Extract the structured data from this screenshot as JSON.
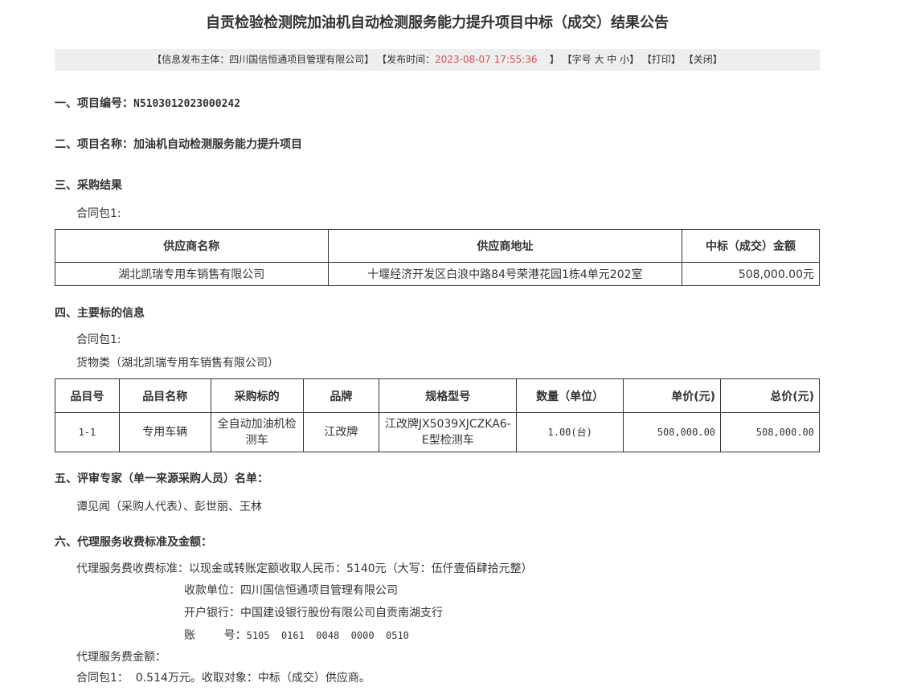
{
  "title": "自贡检验检测院加油机自动检测服务能力提升项目中标（成交）结果公告",
  "meta": {
    "publisher": "【信息发布主体：四川国信恒通项目管理有限公司】",
    "time_label": "【发布时间：",
    "time_value": "2023-08-07 17:55:36",
    "time_close": "】",
    "font_size": "【字号 大 中 小】",
    "print": "【打印】",
    "close": "【关闭】"
  },
  "sec1": {
    "label": "一、项目编号：",
    "value": "N5103012023000242"
  },
  "sec2": {
    "label": "二、项目名称：",
    "value": "加油机自动检测服务能力提升项目"
  },
  "sec3": {
    "heading": "三、采购结果",
    "package": "合同包1:",
    "headers": [
      "供应商名称",
      "供应商地址",
      "中标（成交）金额"
    ],
    "row": [
      "湖北凯瑞专用车销售有限公司",
      "十堰经济开发区白浪中路84号荣港花园1栋4单元202室",
      "508,000.00元"
    ]
  },
  "sec4": {
    "heading": "四、主要标的信息",
    "package": "合同包1:",
    "category": "货物类（湖北凯瑞专用车销售有限公司）",
    "headers": [
      "品目号",
      "品目名称",
      "采购标的",
      "品牌",
      "规格型号",
      "数量（单位）",
      "单价(元)",
      "总价(元)"
    ],
    "row": [
      "1-1",
      "专用车辆",
      "全自动加油机检测车",
      "江改牌",
      "江改牌JX5039XJCZKA6-E型检测车",
      "1.00(台)",
      "508,000.00",
      "508,000.00"
    ]
  },
  "sec5": {
    "heading": "五、评审专家（单一来源采购人员）名单：",
    "names": "谭见闻（采购人代表）、彭世丽、王林"
  },
  "sec6": {
    "heading": "六、代理服务收费标准及金额：",
    "standard": "代理服务费收费标准：以现金或转账定额收取人民币：5140元（大写：伍仟壹佰肆拾元整）",
    "payee": "收款单位：四川国信恒通项目管理有限公司",
    "bank": "开户银行：中国建设银行股份有限公司自贡南湖支行",
    "account_label": "账        号：",
    "account_value": "5105  0161  0048  0000  0510",
    "fee_label": "代理服务费金额：",
    "fee_detail": "合同包1：  0.514万元。收取对象：中标（成交）供应商。"
  }
}
